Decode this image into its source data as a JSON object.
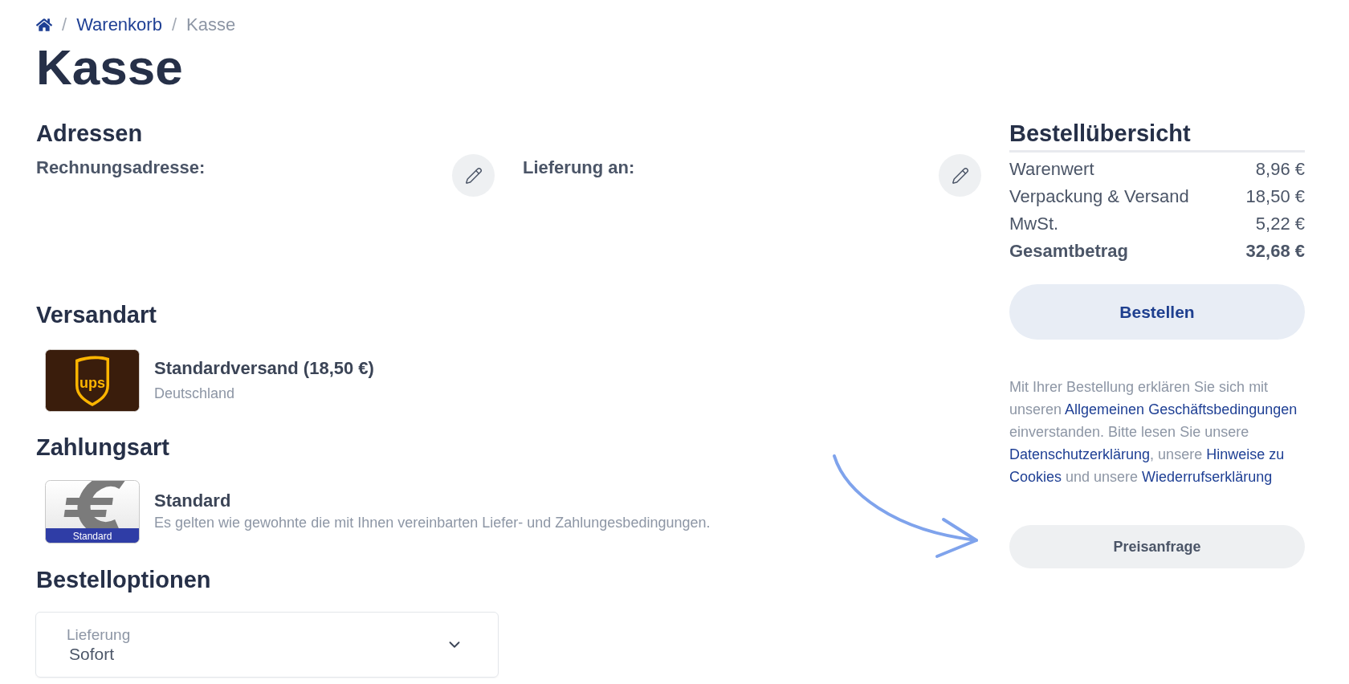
{
  "breadcrumb": [
    {
      "kind": "home"
    },
    {
      "kind": "link",
      "separator": "/",
      "label": "Warenkorb"
    },
    {
      "kind": "current",
      "separator": "/",
      "label": "Kasse"
    }
  ],
  "title": "Kasse",
  "addresses": {
    "heading": "Adressen",
    "blocks": [
      {
        "label": "Rechnungsadresse:"
      },
      {
        "label": "Lieferung an:"
      }
    ]
  },
  "shipping": {
    "heading": "Versandart",
    "method": {
      "logo": {
        "kind": "shield",
        "text": "ups"
      },
      "name": "Standardversand (18,50 €)",
      "detail": "Deutschland"
    }
  },
  "payment": {
    "heading": "Zahlungsart",
    "method": {
      "logo": {
        "kind": "currency",
        "label": "Standard"
      },
      "name": "Standard",
      "detail": "Es gelten wie gewohnte die mit Ihnen vereinbarten Liefer- und Zahlungesbedingungen."
    }
  },
  "order_options": {
    "heading": "Bestelloptionen",
    "select": {
      "label": "Lieferung",
      "value": "Sofort"
    }
  },
  "summary": {
    "heading": "Bestellübersicht",
    "rows": [
      {
        "kind": "line",
        "label": "Warenwert",
        "value": "8,96 €"
      },
      {
        "kind": "line",
        "label": "Verpackung & Versand",
        "value": "18,50 €"
      },
      {
        "kind": "line",
        "label": "MwSt.",
        "value": "5,22 €"
      },
      {
        "kind": "total",
        "label": "Gesamtbetrag",
        "value": "32,68 €"
      }
    ],
    "order_button": "Bestellen",
    "terms": [
      {
        "kind": "text",
        "text": "Mit Ihrer Bestellung erklären Sie sich mit unseren "
      },
      {
        "kind": "link",
        "text": "Allgemeinen Geschäftsbedingungen"
      },
      {
        "kind": "text",
        "text": " einverstanden. Bitte lesen Sie unsere "
      },
      {
        "kind": "link",
        "text": "Datenschutzerklärung"
      },
      {
        "kind": "text",
        "text": ", unsere "
      },
      {
        "kind": "link",
        "text": "Hinweise zu "
      },
      {
        "kind": "link",
        "text": "Cookies"
      },
      {
        "kind": "text",
        "text": " und unsere "
      },
      {
        "kind": "link",
        "text": "Wiederrufserklärung"
      }
    ],
    "quote_button": "Preisanfrage"
  }
}
